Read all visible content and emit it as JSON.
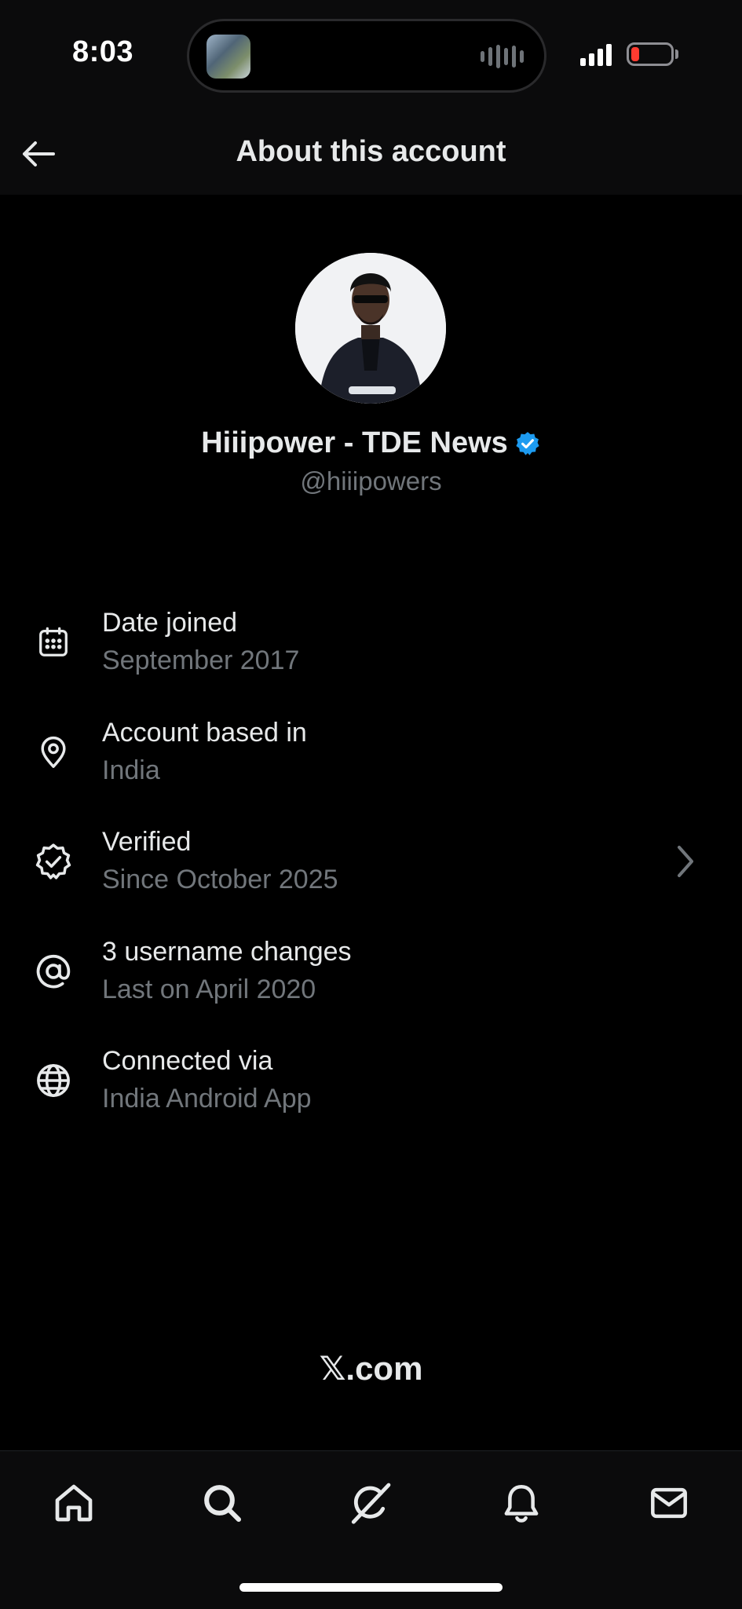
{
  "status_bar": {
    "time": "8:03",
    "icons": [
      "now-playing-thumbnail",
      "audio-waveform-icon",
      "cellular-signal-icon",
      "battery-low-icon"
    ],
    "battery_color": "#ff3b30",
    "battery_level": 0.15
  },
  "header": {
    "title": "About this account",
    "back_icon": "arrow-left-icon"
  },
  "profile": {
    "name": "Hiiipower - TDE News",
    "handle": "@hiiipowers",
    "verified_badge_color": "#1d9bf0"
  },
  "info_items": [
    {
      "icon": "calendar-icon",
      "title": "Date joined",
      "subtitle": "September 2017"
    },
    {
      "icon": "location-pin-icon",
      "title": "Account based in",
      "subtitle": "India"
    },
    {
      "icon": "verified-badge-icon",
      "title": "Verified",
      "subtitle": "Since October 2025",
      "has_chevron": true
    },
    {
      "icon": "at-sign-icon",
      "title": "3 username changes",
      "subtitle": "Last on April 2020"
    },
    {
      "icon": "globe-icon",
      "title": "Connected via",
      "subtitle": "India Android App"
    }
  ],
  "footer": {
    "brand": "𝕏.com"
  },
  "tab_bar": {
    "tabs": [
      "home-icon",
      "search-icon",
      "grok-icon",
      "notifications-bell-icon",
      "messages-envelope-icon"
    ]
  },
  "colors": {
    "background": "#000000",
    "primary_text": "#e7e9ea",
    "secondary_text": "#71767b",
    "accent": "#1d9bf0"
  }
}
